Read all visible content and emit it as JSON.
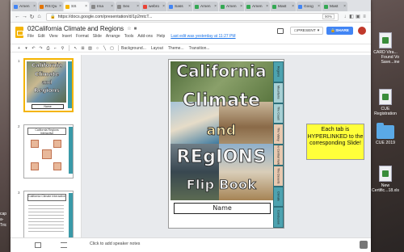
{
  "desktop": {
    "left_text": [
      "cap",
      "a-",
      "Tric"
    ],
    "icons": [
      {
        "label": "CARD Vira...",
        "type": "doc"
      },
      {
        "label": "Found Vo\nSave...ine",
        "type": "doc"
      },
      {
        "label": "CUE\nRegistration",
        "type": "doc"
      },
      {
        "label": "CUE 2019",
        "type": "folder"
      },
      {
        "label": "New\nCertific...18.xls",
        "type": "doc"
      }
    ]
  },
  "browser": {
    "tabs": [
      {
        "label": "Amen",
        "fav": "#4285f4"
      },
      {
        "label": "RS:Qu",
        "fav": "#e37400"
      },
      {
        "label": "SS",
        "fav": "#f4b400",
        "active": true
      },
      {
        "label": "Ima",
        "fav": "#888888"
      },
      {
        "label": "Sex",
        "fav": "#888888"
      },
      {
        "label": "webro",
        "fav": "#ea4335"
      },
      {
        "label": "Sass",
        "fav": "#4285f4"
      },
      {
        "label": "Amen",
        "fav": "#34a853"
      },
      {
        "label": "Amen",
        "fav": "#34a853"
      },
      {
        "label": "Amen",
        "fav": "#34a853"
      },
      {
        "label": "Mast",
        "fav": "#34a853"
      },
      {
        "label": "Goog",
        "fav": "#4285f4"
      },
      {
        "label": "Mast",
        "fav": "#34a853"
      }
    ],
    "url": "https://docs.google.com/presentation/d/1p2mtcT...",
    "zoom": "90%"
  },
  "slides_app": {
    "title": "02California Climate and Regions",
    "menus": [
      "File",
      "Edit",
      "View",
      "Insert",
      "Format",
      "Slide",
      "Arrange",
      "Tools",
      "Add-ons",
      "Help"
    ],
    "last_edit": "Last edit was yesterday at 11:27 PM",
    "present_label": "PRESENT",
    "share_label": "SHARE",
    "toolbar_text": [
      "Background...",
      "Layout",
      "Theme...",
      "Transition..."
    ]
  },
  "filmstrip": {
    "numbers": [
      "1",
      "2",
      "3"
    ],
    "thumb1_title": [
      "California",
      "Climate",
      "and",
      "Regions"
    ],
    "thumb1_name": "Name",
    "thumb2_title": "California Regions Interactive",
    "thumb3_title": "California Climate Interactive"
  },
  "slide": {
    "title_lines": [
      "California",
      "Climate",
      "and",
      "REgIONS",
      "Flip Book"
    ],
    "name_label": "Name",
    "tabs": [
      "Regions",
      "Mountains",
      "The Coast",
      "The Valley",
      "The Central Valley",
      "The Deserts",
      "Climate",
      "Conclusion"
    ]
  },
  "callout": "Each tab is HYPERLINKED to the corresponding Slide!",
  "notes": {
    "placeholder": "Click to add speaker notes"
  }
}
